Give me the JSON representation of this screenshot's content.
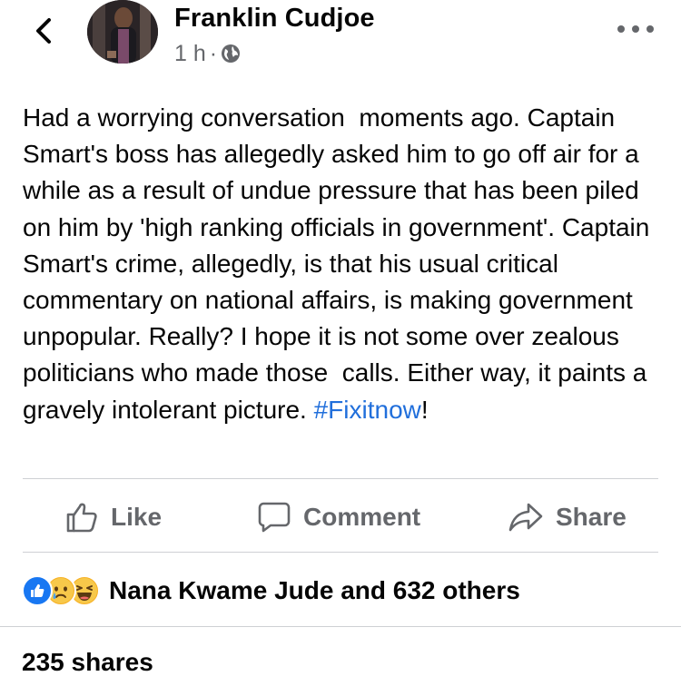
{
  "header": {
    "author_name": "Franklin Cudjoe",
    "time": "1 h",
    "separator": "·",
    "audience_icon": "globe-icon",
    "back_icon": "chevron-left-icon",
    "more_icon": "more-horizontal-icon"
  },
  "post": {
    "text": "Had a worrying conversation  moments ago. Captain Smart's boss has allegedly asked him to go off air for a while as a result of undue pressure that has been piled on him by 'high ranking officials in government'. Captain Smart's crime, allegedly, is that his usual critical commentary on national affairs, is making government unpopular. Really? I hope it is not some over zealous politicians who made those  calls. Either way, it paints a gravely intolerant picture. ",
    "hashtag": "#Fixitnow",
    "trailing": "!"
  },
  "actions": {
    "like": "Like",
    "comment": "Comment",
    "share": "Share"
  },
  "reactions": {
    "icons": [
      "like-reaction-icon",
      "sad-reaction-icon",
      "haha-reaction-icon"
    ],
    "summary": "Nana Kwame Jude and 632 others"
  },
  "shares": "235 shares",
  "colors": {
    "hashtag": "#216fdb",
    "secondary_text": "#65676b",
    "like_blue": "#1877f2",
    "reaction_yellow": "#f7b125"
  }
}
